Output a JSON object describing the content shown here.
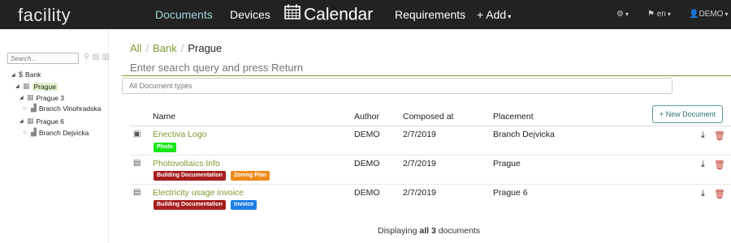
{
  "navbar": {
    "logo": "facility",
    "items": [
      {
        "label": "Documents",
        "active": true
      },
      {
        "label": "Devices",
        "active": false
      },
      {
        "label": "Calendar",
        "active": false
      },
      {
        "label": "Requirements",
        "active": false
      },
      {
        "label": "+ Add",
        "active": false
      }
    ],
    "settings_icon": "gears-icon",
    "language": "en",
    "user": "DEMO"
  },
  "sidebar": {
    "search_placeholder": "Search...",
    "tree": [
      {
        "label": "Bank",
        "icon": "dollar-icon"
      },
      {
        "label": "Prague",
        "icon": "building-icon",
        "selected": true
      },
      {
        "label": "Prague 3",
        "icon": "building-icon"
      },
      {
        "label": "Branch Vinohradska",
        "icon": "building-icon"
      },
      {
        "label": "Prague 6",
        "icon": "building-icon"
      },
      {
        "label": "Branch Dejvicka",
        "icon": "building-icon"
      }
    ]
  },
  "breadcrumb": {
    "items": [
      "All",
      "Bank",
      "Prague"
    ]
  },
  "search": {
    "placeholder": "Enter search query and press Return"
  },
  "type_filter": {
    "value": "All Document types"
  },
  "new_document_label": "+ New Document",
  "table": {
    "columns": [
      "Name",
      "Author",
      "Composed at",
      "Placement"
    ],
    "rows": [
      {
        "name": "Enectiva Logo",
        "icon": "image-file-icon",
        "tags": [
          {
            "label": "Photo",
            "color": "#19e619"
          }
        ],
        "author": "DEMO",
        "composed_at": "2/7/2019",
        "placement": "Branch Dejvicka"
      },
      {
        "name": "Photovoltaics Info",
        "icon": "pdf-file-icon",
        "tags": [
          {
            "label": "Building Documentation",
            "color": "#a61e1e"
          },
          {
            "label": "Zoning Plan",
            "color": "#f08a1c"
          }
        ],
        "author": "DEMO",
        "composed_at": "2/7/2019",
        "placement": "Prague"
      },
      {
        "name": "Electricity usage invoice",
        "icon": "pdf-file-icon",
        "tags": [
          {
            "label": "Building Documentation",
            "color": "#a61e1e"
          },
          {
            "label": "Invoice",
            "color": "#1e7ee6"
          }
        ],
        "author": "DEMO",
        "composed_at": "2/7/2019",
        "placement": "Prague 6"
      }
    ]
  },
  "footer": {
    "prefix": "Displaying",
    "count_text": "all 3",
    "suffix": "documents"
  },
  "colors": {
    "accent": "#7a9b2f",
    "navbar": "#222222",
    "nav_active": "#9fd4d4",
    "delete": "#c0392b"
  }
}
